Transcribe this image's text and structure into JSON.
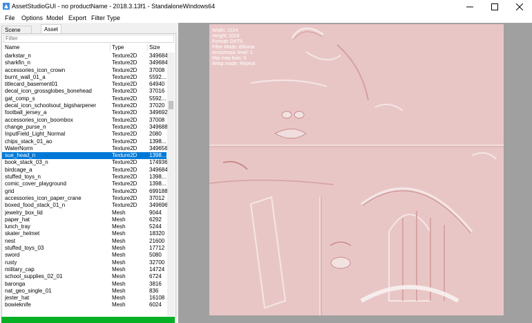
{
  "window": {
    "title": "AssetStudioGUI - no productName - 2018.3.13f1 - StandaloneWindows64"
  },
  "menu": [
    "File",
    "Options",
    "Model",
    "Export",
    "Filter Type"
  ],
  "tabs": [
    "Scene Hierarchy",
    "Asset List"
  ],
  "filter_placeholder": "Filter",
  "columns": [
    "Name",
    "Type",
    "Size"
  ],
  "rows": [
    [
      "darkstar_n",
      "Texture2D",
      "349684"
    ],
    [
      "sharkfin_n",
      "Texture2D",
      "349684"
    ],
    [
      "accessories_icon_crown",
      "Texture2D",
      "37008"
    ],
    [
      "burnt_wall_01_a",
      "Texture2D",
      "5592..."
    ],
    [
      "titlecard_basement01",
      "Texture2D",
      "64940"
    ],
    [
      "decal_icon_grossglobes_bonehead",
      "Texture2D",
      "37016"
    ],
    [
      "gat_comp_s",
      "Texture2D",
      "5592..."
    ],
    [
      "decal_icon_schoolsout_bigsharpener",
      "Texture2D",
      "37020"
    ],
    [
      "football_jersey_a",
      "Texture2D",
      "349692"
    ],
    [
      "accessories_icon_boombox",
      "Texture2D",
      "37008"
    ],
    [
      "change_purse_n",
      "Texture2D",
      "349688"
    ],
    [
      "InputField_Light_Normal",
      "Texture2D",
      "2080"
    ],
    [
      "chips_stack_01_ao",
      "Texture2D",
      "1398..."
    ],
    [
      "WaterNorm",
      "Texture2D",
      "349656"
    ],
    [
      "sue_head_n",
      "Texture2D",
      "1398..."
    ],
    [
      "book_stack_03_n",
      "Texture2D",
      "174936"
    ],
    [
      "birdcage_a",
      "Texture2D",
      "349684"
    ],
    [
      "stuffed_toys_n",
      "Texture2D",
      "1398..."
    ],
    [
      "comic_cover_playground",
      "Texture2D",
      "1398..."
    ],
    [
      "grid",
      "Texture2D",
      "699188"
    ],
    [
      "accessories_icon_paper_crane",
      "Texture2D",
      "37012"
    ],
    [
      "boxed_food_stack_01_n",
      "Texture2D",
      "349696"
    ],
    [
      "jewelry_box_lid",
      "Mesh",
      "9044"
    ],
    [
      "paper_hat",
      "Mesh",
      "6292"
    ],
    [
      "lunch_tray",
      "Mesh",
      "5244"
    ],
    [
      "skater_helmet",
      "Mesh",
      "18320"
    ],
    [
      "nest",
      "Mesh",
      "21600"
    ],
    [
      "stuffed_toys_03",
      "Mesh",
      "17712"
    ],
    [
      "sword",
      "Mesh",
      "5080"
    ],
    [
      "rusty",
      "Mesh",
      "32700"
    ],
    [
      "military_cap",
      "Mesh",
      "14724"
    ],
    [
      "school_supplies_02_01",
      "Mesh",
      "6724"
    ],
    [
      "baronga",
      "Mesh",
      "3816"
    ],
    [
      "nat_geo_single_01",
      "Mesh",
      "836"
    ],
    [
      "jester_hat",
      "Mesh",
      "16108"
    ],
    [
      "bowieknife",
      "Mesh",
      "6024"
    ]
  ],
  "selected_row": "sue_head_n",
  "progress_fraction": 1.0,
  "texture_info": [
    "Width: 1024",
    "Height: 1024",
    "Format: DXT5",
    "Filter Mode: Bilinear",
    "Anisotropic level: 1",
    "Mip map bias: 0",
    "Wrap mode: Repeat"
  ],
  "colors": {
    "selection": "#0078d7",
    "progress": "#06b025",
    "preview_bg": "#a0a0a0",
    "texture_base": "#e8c8c8"
  },
  "icons": {
    "app": "app-icon",
    "minimize": "minimize-icon",
    "maximize": "maximize-icon",
    "close": "close-icon"
  }
}
